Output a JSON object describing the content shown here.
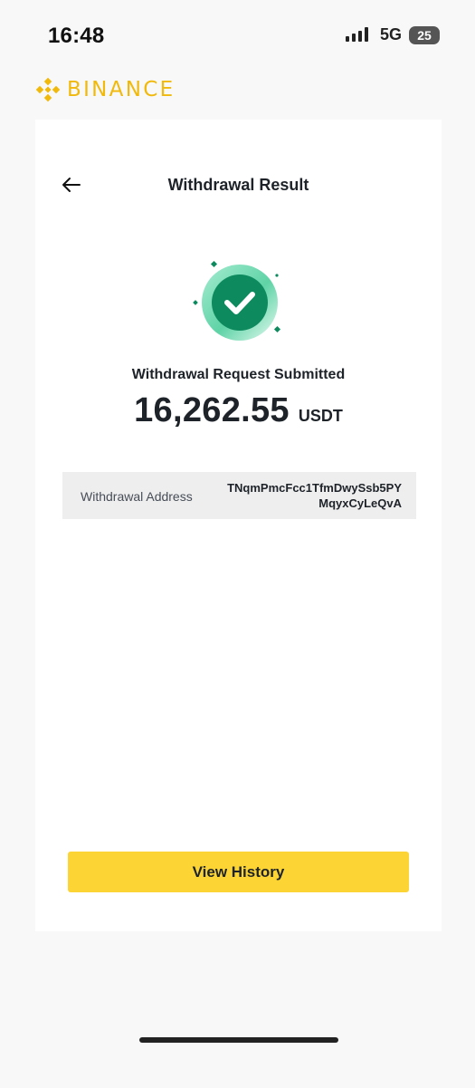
{
  "status_bar": {
    "time": "16:48",
    "network": "5G",
    "battery": "25"
  },
  "brand": {
    "name": "BINANCE",
    "color": "#F0B90B",
    "icon": "binance-logo-icon"
  },
  "header": {
    "title": "Withdrawal Result",
    "back_icon": "arrow-left-icon"
  },
  "result": {
    "status_icon": "check-circle-icon",
    "status_color": "#0E8A5F",
    "message": "Withdrawal Request Submitted",
    "amount": "16,262.55",
    "unit": "USDT"
  },
  "details": {
    "address_label": "Withdrawal Address",
    "address_line1": "TNqmPmcFcc1TfmDwySsb5PY",
    "address_line2": "MqyxCyLeQvA"
  },
  "actions": {
    "view_history_label": "View History",
    "button_color": "#FCD535"
  }
}
